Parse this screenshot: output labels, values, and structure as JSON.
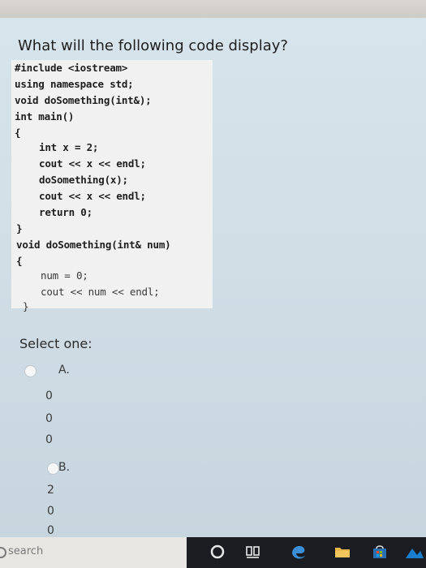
{
  "question": {
    "title": "What will the following code display?"
  },
  "code": {
    "lines": [
      "#include <iostream>",
      "using namespace std;",
      "void doSomething(int&);",
      "int main()",
      "{",
      "int x = 2;",
      "cout << x << endl;",
      "doSomething(x);",
      "cout << x << endl;",
      "return 0;",
      "}",
      "void doSomething(int& num)",
      "{",
      "num = 0;",
      "cout << num << endl;",
      "}"
    ]
  },
  "answers": {
    "prompt": "Select one:",
    "options": [
      {
        "letter": "A.",
        "values": [
          "0",
          "0",
          "0"
        ]
      },
      {
        "letter": "B.",
        "values": [
          "2",
          "0",
          "0"
        ]
      }
    ]
  },
  "taskbar": {
    "search_placeholder": "search"
  }
}
